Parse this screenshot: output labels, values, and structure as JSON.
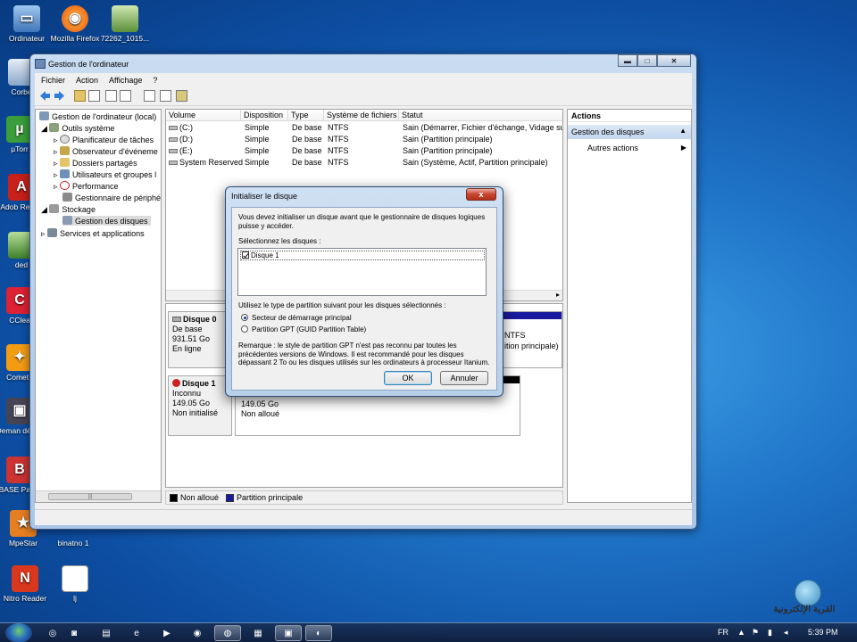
{
  "desktop": {
    "icons": [
      {
        "label": "Ordinateur",
        "icon": "computer-icon"
      },
      {
        "label": "Mozilla Firefox",
        "icon": "firefox-icon"
      },
      {
        "label": "72262_1015...",
        "icon": "image-file-icon"
      },
      {
        "label": "Corbe",
        "icon": "recycle-bin-icon"
      },
      {
        "label": "µTorr",
        "icon": "utorrent-icon"
      },
      {
        "label": "Adob Reade",
        "icon": "adobe-reader-icon"
      },
      {
        "label": "ded",
        "icon": "image-file-icon"
      },
      {
        "label": "CClea",
        "icon": "ccleaner-icon"
      },
      {
        "label": "Comet I",
        "icon": "comet-icon"
      },
      {
        "label": "Deman détect",
        "icon": "app-icon"
      },
      {
        "label": "BASE Partiti",
        "icon": "app-icon"
      },
      {
        "label": "MpeStar",
        "icon": "app-icon"
      },
      {
        "label": "binatno 1",
        "icon": "file-icon"
      },
      {
        "label": "Nitro Reader",
        "icon": "nitro-reader-icon"
      },
      {
        "label": "lj",
        "icon": "document-icon"
      }
    ]
  },
  "window": {
    "title": "Gestion de l'ordinateur",
    "minimize": "▬",
    "maximize": "□",
    "close": "✕",
    "menu": [
      "Fichier",
      "Action",
      "Affichage",
      "?"
    ]
  },
  "tree": {
    "root": "Gestion de l'ordinateur (local)",
    "system_tools": "Outils système",
    "items": [
      "Planificateur de tâches",
      "Observateur d'événeme",
      "Dossiers partagés",
      "Utilisateurs et groupes l",
      "Performance",
      "Gestionnaire de périphé"
    ],
    "storage": "Stockage",
    "disk_mgmt": "Gestion des disques",
    "services": "Services et applications",
    "scroll_grip": "|||"
  },
  "volumes": {
    "headers": [
      "Volume",
      "Disposition",
      "Type",
      "Système de fichiers",
      "Statut"
    ],
    "rows": [
      [
        "(C:)",
        "Simple",
        "De base",
        "NTFS",
        "Sain (Démarrer, Fichier d'échange, Vidage sur"
      ],
      [
        "(D:)",
        "Simple",
        "De base",
        "NTFS",
        "Sain (Partition principale)"
      ],
      [
        "(E:)",
        "Simple",
        "De base",
        "NTFS",
        "Sain (Partition principale)"
      ],
      [
        "System Reserved",
        "Simple",
        "De base",
        "NTFS",
        "Sain (Système, Actif, Partition principale)"
      ]
    ]
  },
  "disks": {
    "disk0": {
      "name": "Disque 0",
      "type": "De base",
      "size": "931.51 Go",
      "state": "En ligne",
      "part_fs": "NTFS",
      "part_status": "ition principale)"
    },
    "disk1": {
      "name": "Disque 1",
      "type": "Inconnu",
      "size": "149.05 Go",
      "state": "Non initialisé",
      "part_size": "149.05 Go",
      "part_status": "Non alloué"
    }
  },
  "legend": {
    "unallocated": "Non alloué",
    "primary": "Partition principale"
  },
  "colors": {
    "unallocated": "#000000",
    "primary": "#1a1aa0"
  },
  "actions": {
    "title": "Actions",
    "selected": "Gestion des disques",
    "sub": "Autres actions"
  },
  "dialog": {
    "title": "Initialiser le disque",
    "close": "x",
    "intro": "Vous devez initialiser un disque avant que le gestionnaire de disques logiques puisse y accéder.",
    "select_label": "Sélectionnez les disques :",
    "disk_item": "Disque 1",
    "partition_label": "Utilisez le type de partition suivant pour les disques sélectionnés :",
    "option_mbr": "Secteur de démarrage principal",
    "option_gpt": "Partition GPT (GUID Partition Table)",
    "note": "Remarque : le style de partition GPT n'est pas reconnu par toutes les précédentes versions de Windows. Il est recommandé pour les disques dépassant 2 To ou les disques utilisés sur les ordinateurs à processeur Itanium.",
    "ok": "OK",
    "cancel": "Annuler"
  },
  "taskbar": {
    "language": "FR",
    "time": "5:39 PM"
  },
  "watermark": "القرية الإلكترونية"
}
